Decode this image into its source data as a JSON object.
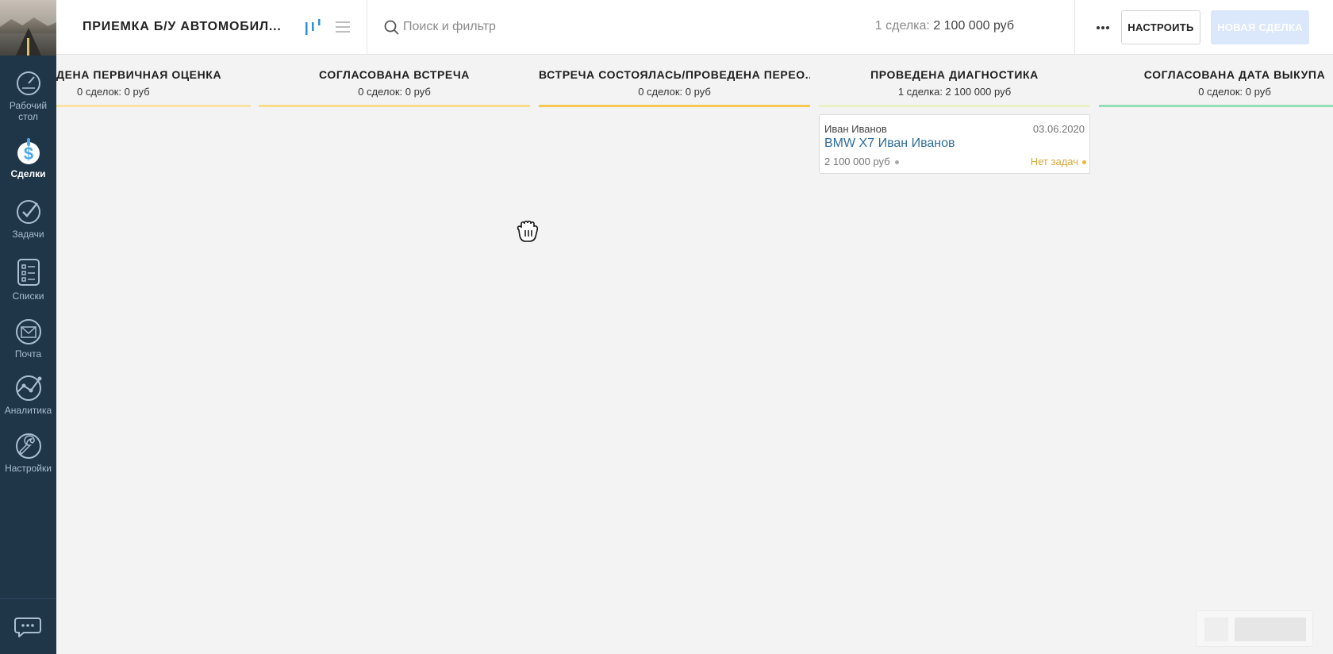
{
  "sidebar": {
    "items": [
      {
        "label": "Рабочий\nстол",
        "icon": "dashboard-icon",
        "active": false
      },
      {
        "label": "Сделки",
        "icon": "deals-icon",
        "active": true
      },
      {
        "label": "Задачи",
        "icon": "tasks-icon",
        "active": false
      },
      {
        "label": "Списки",
        "icon": "lists-icon",
        "active": false
      },
      {
        "label": "Почта",
        "icon": "mail-icon",
        "active": false
      },
      {
        "label": "Аналитика",
        "icon": "analytics-icon",
        "active": false
      },
      {
        "label": "Настройки",
        "icon": "settings-icon",
        "active": false
      }
    ],
    "chat_icon": "chat-icon"
  },
  "header": {
    "pipeline_title": "ПРИЕМКА Б/У АВТОМОБИЛ...",
    "search_placeholder": "Поиск и фильтр",
    "summary_label": "1 сделка:",
    "summary_value": "2 100 000 руб",
    "setup_label": "НАСТРОИТЬ",
    "new_deal_label": "НОВАЯ СДЕЛКА"
  },
  "columns": [
    {
      "title": "ДЕНА ПЕРВИЧНАЯ ОЦЕНКА",
      "stats": "0 сделок: 0 руб",
      "color": "#f9e2a3"
    },
    {
      "title": "СОГЛАСОВАНА ВСТРЕЧА",
      "stats": "0 сделок: 0 руб",
      "color": "#f8dc8c"
    },
    {
      "title": "ВСТРЕЧА СОСТОЯЛАСЬ/ПРОВЕДЕНА ПЕРЕО...",
      "stats": "0 сделок: 0 руб",
      "color": "#f6c84f"
    },
    {
      "title": "ПРОВЕДЕНА ДИАГНОСТИКА",
      "stats": "1 сделка: 2 100 000 руб",
      "color": "#e8f0c6"
    },
    {
      "title": "СОГЛАСОВАНА ДАТА ВЫКУПА",
      "stats": "0 сделок: 0 руб",
      "color": "#8fe0b8"
    }
  ],
  "deal": {
    "contact": "Иван Иванов",
    "date": "03.06.2020",
    "name": "BMW X7 Иван Иванов",
    "price": "2 100 000 руб",
    "tasks": "Нет задач"
  }
}
